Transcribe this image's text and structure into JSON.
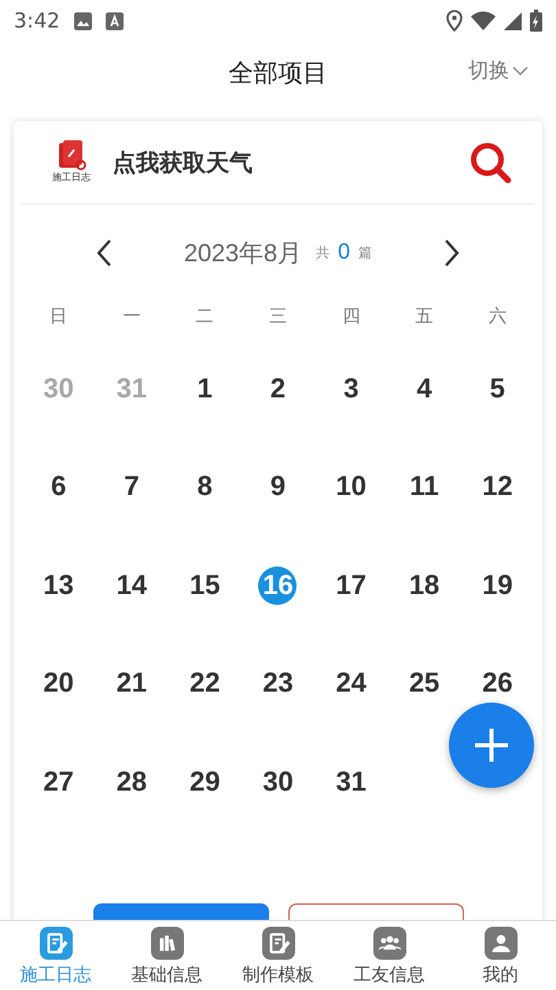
{
  "status_bar": {
    "time": "3:42"
  },
  "header": {
    "title": "全部项目",
    "switch": "切换"
  },
  "weather": {
    "logo_text": "施工日志",
    "label": "点我获取天气"
  },
  "calendar": {
    "month": "2023年8月",
    "total_prefix": "共",
    "total": "0",
    "total_suffix": "篇",
    "weekdays": [
      "日",
      "一",
      "二",
      "三",
      "四",
      "五",
      "六"
    ],
    "days": [
      {
        "day": "30",
        "muted": true,
        "selected": false
      },
      {
        "day": "31",
        "muted": true,
        "selected": false
      },
      {
        "day": "1",
        "muted": false,
        "selected": false
      },
      {
        "day": "2",
        "muted": false,
        "selected": false
      },
      {
        "day": "3",
        "muted": false,
        "selected": false
      },
      {
        "day": "4",
        "muted": false,
        "selected": false
      },
      {
        "day": "5",
        "muted": false,
        "selected": false
      },
      {
        "day": "6",
        "muted": false,
        "selected": false
      },
      {
        "day": "7",
        "muted": false,
        "selected": false
      },
      {
        "day": "8",
        "muted": false,
        "selected": false
      },
      {
        "day": "9",
        "muted": false,
        "selected": false
      },
      {
        "day": "10",
        "muted": false,
        "selected": false
      },
      {
        "day": "11",
        "muted": false,
        "selected": false
      },
      {
        "day": "12",
        "muted": false,
        "selected": false
      },
      {
        "day": "13",
        "muted": false,
        "selected": false
      },
      {
        "day": "14",
        "muted": false,
        "selected": false
      },
      {
        "day": "15",
        "muted": false,
        "selected": false
      },
      {
        "day": "16",
        "muted": false,
        "selected": true
      },
      {
        "day": "17",
        "muted": false,
        "selected": false
      },
      {
        "day": "18",
        "muted": false,
        "selected": false
      },
      {
        "day": "19",
        "muted": false,
        "selected": false
      },
      {
        "day": "20",
        "muted": false,
        "selected": false
      },
      {
        "day": "21",
        "muted": false,
        "selected": false
      },
      {
        "day": "22",
        "muted": false,
        "selected": false
      },
      {
        "day": "23",
        "muted": false,
        "selected": false
      },
      {
        "day": "24",
        "muted": false,
        "selected": false
      },
      {
        "day": "25",
        "muted": false,
        "selected": false
      },
      {
        "day": "26",
        "muted": false,
        "selected": false
      },
      {
        "day": "27",
        "muted": false,
        "selected": false
      },
      {
        "day": "28",
        "muted": false,
        "selected": false
      },
      {
        "day": "29",
        "muted": false,
        "selected": false
      },
      {
        "day": "30",
        "muted": false,
        "selected": false
      },
      {
        "day": "31",
        "muted": false,
        "selected": false
      }
    ]
  },
  "tab_bar": [
    {
      "label": "施工日志",
      "selected": true
    },
    {
      "label": "基础信息",
      "selected": false
    },
    {
      "label": "制作模板",
      "selected": false
    },
    {
      "label": "工友信息",
      "selected": false
    },
    {
      "label": "我的",
      "selected": false
    }
  ]
}
